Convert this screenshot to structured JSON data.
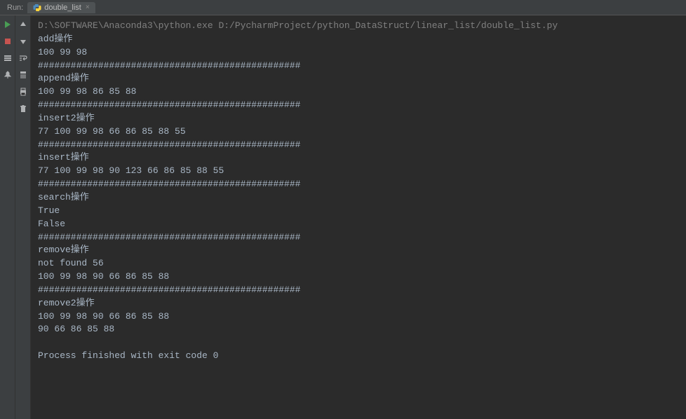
{
  "topbar": {
    "run_label": "Run:",
    "tab_name": "double_list",
    "tab_close": "×"
  },
  "console": {
    "lines": [
      {
        "cls": "cmd-line",
        "text": "D:\\SOFTWARE\\Anaconda3\\python.exe D:/PycharmProject/python_DataStruct/linear_list/double_list.py"
      },
      {
        "cls": "out",
        "text": "add操作"
      },
      {
        "cls": "out",
        "text": "100 99 98"
      },
      {
        "cls": "out",
        "text": "################################################"
      },
      {
        "cls": "out",
        "text": "append操作"
      },
      {
        "cls": "out",
        "text": "100 99 98 86 85 88"
      },
      {
        "cls": "out",
        "text": "################################################"
      },
      {
        "cls": "out",
        "text": "insert2操作"
      },
      {
        "cls": "out",
        "text": "77 100 99 98 66 86 85 88 55"
      },
      {
        "cls": "out",
        "text": "################################################"
      },
      {
        "cls": "out",
        "text": "insert操作"
      },
      {
        "cls": "out",
        "text": "77 100 99 98 90 123 66 86 85 88 55"
      },
      {
        "cls": "out",
        "text": "################################################"
      },
      {
        "cls": "out",
        "text": "search操作"
      },
      {
        "cls": "out",
        "text": "True"
      },
      {
        "cls": "out",
        "text": "False"
      },
      {
        "cls": "out",
        "text": "################################################"
      },
      {
        "cls": "out",
        "text": "remove操作"
      },
      {
        "cls": "out",
        "text": "not found 56"
      },
      {
        "cls": "out",
        "text": "100 99 98 90 66 86 85 88"
      },
      {
        "cls": "out",
        "text": "################################################"
      },
      {
        "cls": "out",
        "text": "remove2操作"
      },
      {
        "cls": "out",
        "text": "100 99 98 90 66 86 85 88"
      },
      {
        "cls": "out",
        "text": "90 66 86 85 88"
      },
      {
        "cls": "out",
        "text": ""
      },
      {
        "cls": "out",
        "text": "Process finished with exit code 0"
      }
    ]
  }
}
